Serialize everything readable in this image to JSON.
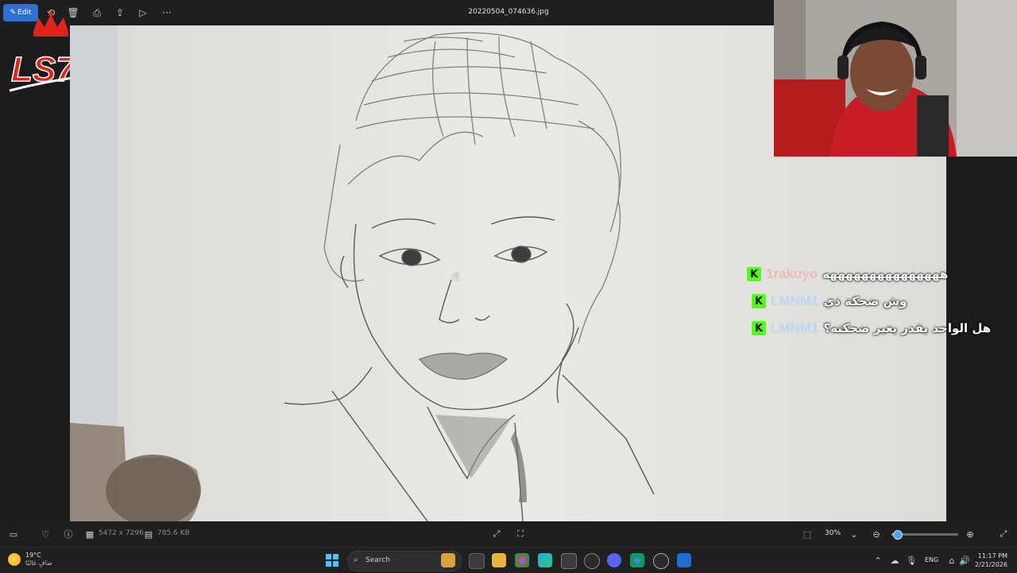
{
  "titlebar": {
    "edit_label": "Edit",
    "filename": "20220504_074636.jpg",
    "tools": [
      "crop-icon",
      "delete-icon",
      "print-icon",
      "share-icon",
      "slideshow-icon",
      "more-icon"
    ]
  },
  "bottombar": {
    "dimensions": "5472 x 7296",
    "file_size": "785.6 KB",
    "zoom": "30%",
    "zoom_fraction": 0.08
  },
  "chat": {
    "messages": [
      {
        "user": "1rakuyo",
        "text": "هههههههههههههههه",
        "user_color": "#f2b8b8"
      },
      {
        "user": "LMNM1",
        "text": "وش ضحكة ذي",
        "user_color": "#b9d7f5"
      },
      {
        "user": "LMNM1",
        "text": "هل الواحد يقدر يغير ضحكته؟",
        "user_color": "#b9d7f5"
      }
    ]
  },
  "logo": {
    "text": "LS7"
  },
  "taskbar": {
    "weather_temp": "19°C",
    "weather_desc": "صافٍ غالبًا",
    "search_label": "Search",
    "language": "ENG",
    "time": "11:17 PM",
    "date": "2/21/2026"
  },
  "colors": {
    "accent": "#2f6fd0",
    "kick_green": "#53fc18",
    "chrome_bg": "#1f1f1f"
  }
}
